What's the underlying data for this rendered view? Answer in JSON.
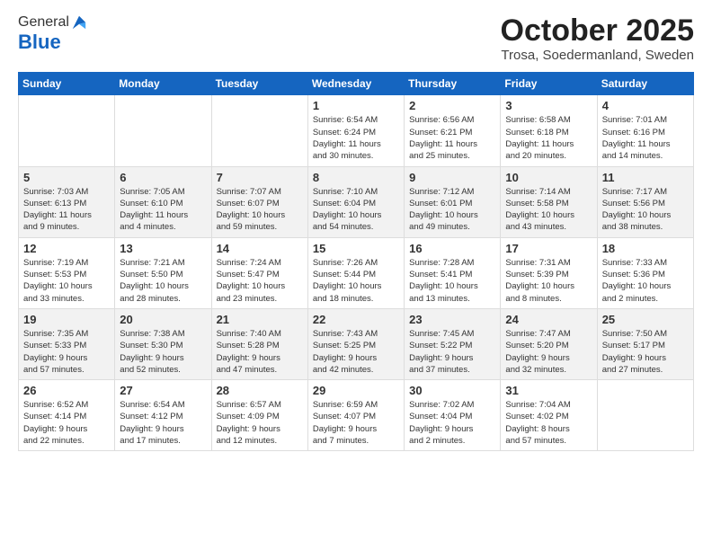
{
  "header": {
    "logo_general": "General",
    "logo_blue": "Blue",
    "month_title": "October 2025",
    "location": "Trosa, Soedermanland, Sweden"
  },
  "weekdays": [
    "Sunday",
    "Monday",
    "Tuesday",
    "Wednesday",
    "Thursday",
    "Friday",
    "Saturday"
  ],
  "weeks": [
    [
      {
        "day": "",
        "info": ""
      },
      {
        "day": "",
        "info": ""
      },
      {
        "day": "",
        "info": ""
      },
      {
        "day": "1",
        "info": "Sunrise: 6:54 AM\nSunset: 6:24 PM\nDaylight: 11 hours\nand 30 minutes."
      },
      {
        "day": "2",
        "info": "Sunrise: 6:56 AM\nSunset: 6:21 PM\nDaylight: 11 hours\nand 25 minutes."
      },
      {
        "day": "3",
        "info": "Sunrise: 6:58 AM\nSunset: 6:18 PM\nDaylight: 11 hours\nand 20 minutes."
      },
      {
        "day": "4",
        "info": "Sunrise: 7:01 AM\nSunset: 6:16 PM\nDaylight: 11 hours\nand 14 minutes."
      }
    ],
    [
      {
        "day": "5",
        "info": "Sunrise: 7:03 AM\nSunset: 6:13 PM\nDaylight: 11 hours\nand 9 minutes."
      },
      {
        "day": "6",
        "info": "Sunrise: 7:05 AM\nSunset: 6:10 PM\nDaylight: 11 hours\nand 4 minutes."
      },
      {
        "day": "7",
        "info": "Sunrise: 7:07 AM\nSunset: 6:07 PM\nDaylight: 10 hours\nand 59 minutes."
      },
      {
        "day": "8",
        "info": "Sunrise: 7:10 AM\nSunset: 6:04 PM\nDaylight: 10 hours\nand 54 minutes."
      },
      {
        "day": "9",
        "info": "Sunrise: 7:12 AM\nSunset: 6:01 PM\nDaylight: 10 hours\nand 49 minutes."
      },
      {
        "day": "10",
        "info": "Sunrise: 7:14 AM\nSunset: 5:58 PM\nDaylight: 10 hours\nand 43 minutes."
      },
      {
        "day": "11",
        "info": "Sunrise: 7:17 AM\nSunset: 5:56 PM\nDaylight: 10 hours\nand 38 minutes."
      }
    ],
    [
      {
        "day": "12",
        "info": "Sunrise: 7:19 AM\nSunset: 5:53 PM\nDaylight: 10 hours\nand 33 minutes."
      },
      {
        "day": "13",
        "info": "Sunrise: 7:21 AM\nSunset: 5:50 PM\nDaylight: 10 hours\nand 28 minutes."
      },
      {
        "day": "14",
        "info": "Sunrise: 7:24 AM\nSunset: 5:47 PM\nDaylight: 10 hours\nand 23 minutes."
      },
      {
        "day": "15",
        "info": "Sunrise: 7:26 AM\nSunset: 5:44 PM\nDaylight: 10 hours\nand 18 minutes."
      },
      {
        "day": "16",
        "info": "Sunrise: 7:28 AM\nSunset: 5:41 PM\nDaylight: 10 hours\nand 13 minutes."
      },
      {
        "day": "17",
        "info": "Sunrise: 7:31 AM\nSunset: 5:39 PM\nDaylight: 10 hours\nand 8 minutes."
      },
      {
        "day": "18",
        "info": "Sunrise: 7:33 AM\nSunset: 5:36 PM\nDaylight: 10 hours\nand 2 minutes."
      }
    ],
    [
      {
        "day": "19",
        "info": "Sunrise: 7:35 AM\nSunset: 5:33 PM\nDaylight: 9 hours\nand 57 minutes."
      },
      {
        "day": "20",
        "info": "Sunrise: 7:38 AM\nSunset: 5:30 PM\nDaylight: 9 hours\nand 52 minutes."
      },
      {
        "day": "21",
        "info": "Sunrise: 7:40 AM\nSunset: 5:28 PM\nDaylight: 9 hours\nand 47 minutes."
      },
      {
        "day": "22",
        "info": "Sunrise: 7:43 AM\nSunset: 5:25 PM\nDaylight: 9 hours\nand 42 minutes."
      },
      {
        "day": "23",
        "info": "Sunrise: 7:45 AM\nSunset: 5:22 PM\nDaylight: 9 hours\nand 37 minutes."
      },
      {
        "day": "24",
        "info": "Sunrise: 7:47 AM\nSunset: 5:20 PM\nDaylight: 9 hours\nand 32 minutes."
      },
      {
        "day": "25",
        "info": "Sunrise: 7:50 AM\nSunset: 5:17 PM\nDaylight: 9 hours\nand 27 minutes."
      }
    ],
    [
      {
        "day": "26",
        "info": "Sunrise: 6:52 AM\nSunset: 4:14 PM\nDaylight: 9 hours\nand 22 minutes."
      },
      {
        "day": "27",
        "info": "Sunrise: 6:54 AM\nSunset: 4:12 PM\nDaylight: 9 hours\nand 17 minutes."
      },
      {
        "day": "28",
        "info": "Sunrise: 6:57 AM\nSunset: 4:09 PM\nDaylight: 9 hours\nand 12 minutes."
      },
      {
        "day": "29",
        "info": "Sunrise: 6:59 AM\nSunset: 4:07 PM\nDaylight: 9 hours\nand 7 minutes."
      },
      {
        "day": "30",
        "info": "Sunrise: 7:02 AM\nSunset: 4:04 PM\nDaylight: 9 hours\nand 2 minutes."
      },
      {
        "day": "31",
        "info": "Sunrise: 7:04 AM\nSunset: 4:02 PM\nDaylight: 8 hours\nand 57 minutes."
      },
      {
        "day": "",
        "info": ""
      }
    ]
  ]
}
